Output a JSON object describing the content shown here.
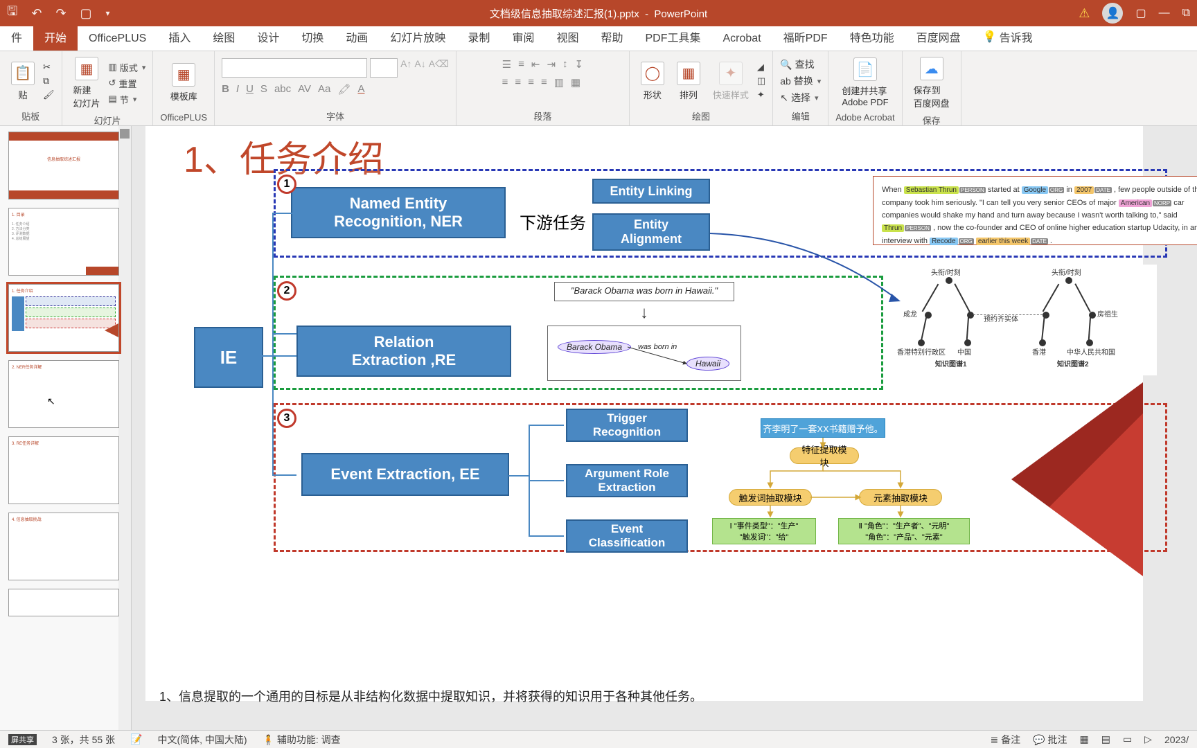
{
  "titlebar": {
    "filename": "文档级信息抽取综述汇报(1).pptx",
    "app": "PowerPoint"
  },
  "tabs": {
    "file": "件",
    "home": "开始",
    "officeplus": "OfficePLUS",
    "insert": "插入",
    "draw": "绘图",
    "design": "设计",
    "transitions": "切换",
    "animations": "动画",
    "slideshow": "幻灯片放映",
    "record": "录制",
    "review": "审阅",
    "view": "视图",
    "help": "帮助",
    "pdftools": "PDF工具集",
    "acrobat": "Acrobat",
    "foxit": "福昕PDF",
    "special": "特色功能",
    "baidu": "百度网盘",
    "tellme": "告诉我"
  },
  "ribbon": {
    "paste": "贴",
    "clipboard": "贴板",
    "newslide": "新建\n幻灯片",
    "layout": "版式",
    "reset": "重置",
    "section": "节",
    "slides": "幻灯片",
    "template": "模板库",
    "officeplus": "OfficePLUS",
    "font": "字体",
    "paragraph": "段落",
    "shapes": "形状",
    "arrange": "排列",
    "quickstyle": "快速样式",
    "drawing": "绘图",
    "find": "查找",
    "replace": "替换",
    "select": "选择",
    "editing": "编辑",
    "adobepdf": "创建并共享\nAdobe PDF",
    "adobegroup": "Adobe Acrobat",
    "baidusave": "保存到\n百度网盘",
    "save": "保存"
  },
  "slide": {
    "title": "1、任务介绍",
    "ie": "IE",
    "ner": "Named Entity\nRecognition, NER",
    "downstream": "下游任务",
    "entitylinking": "Entity Linking",
    "entityalignment": "Entity\nAlignment",
    "re": "Relation\nExtraction ,RE",
    "ee": "Event Extraction, EE",
    "trigger": "Trigger\nRecognition",
    "argrole": "Argument Role\nExtraction",
    "eventcls": "Event\nClassification",
    "re_sentence": "\"Barack Obama was born in Hawaii.\"",
    "re_subj": "Barack Obama",
    "re_rel": "was born in",
    "re_obj": "Hawaii",
    "ner_sample": {
      "t1": "When ",
      "s1": "Sebastian Thrun",
      "t2": " started at ",
      "s2": "Google",
      "t3": " in ",
      "s3": "2007",
      "t4": " , few people outside of the company took him seriously. \"I can tell you very senior CEOs of major ",
      "s4": "American",
      "t5": " car companies would shake my hand and turn away because I wasn't worth talking to,\" said ",
      "s5": "Thrun",
      "t6": " , now the co-founder and CEO of online higher education startup Udacity, in an interview with ",
      "s6": "Recode",
      "t7": " ",
      "s7": "earlier this week",
      "t8": " ."
    },
    "kg1_title": "知识图谱1",
    "kg2_title": "知识图谱2",
    "kg_labels": {
      "a1": "头衔/时刻",
      "a2": "头衔/时刻",
      "b1": "成龙",
      "b2": "房祖生",
      "b3": "预约齐实体",
      "c1": "香港特别行政区",
      "c2": "中国",
      "c3": "香港",
      "c4": "中华人民共和国"
    },
    "ee_example": "齐李明了一套XX书籍赠予他。",
    "ee_feat": "特征提取模块",
    "ee_trig": "触发词抽取模块",
    "ee_elem": "元素抽取模块",
    "ee_out1": "Ⅰ \"事件类型\"：\"生产\"\n\"触发词\"：\"给\"",
    "ee_out2": "Ⅱ \"角色\"：\"生产者\"、\"元明\"\n\"角色\"：\"产品\"、\"元素\"",
    "footnote": "1、信息提取的一个通用的目标是从非结构化数据中提取知识，并将获得的知识用于各种其他任务。"
  },
  "status": {
    "slideno": "3 张，共 55 张",
    "lang": "中文(简体, 中国大陆)",
    "access": "辅助功能: 调查",
    "notes": "备注",
    "comments": "批注",
    "date": "2023/"
  }
}
